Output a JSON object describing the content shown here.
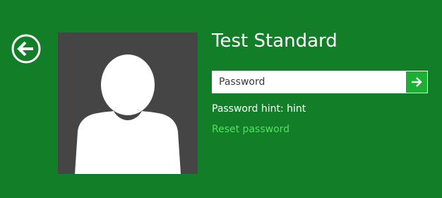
{
  "user": {
    "name": "Test Standard"
  },
  "password": {
    "placeholder": "Password",
    "value": ""
  },
  "hint": {
    "label": "Password hint:",
    "value": "hint"
  },
  "links": {
    "reset_password": "Reset password"
  },
  "icons": {
    "back": "back-arrow-icon",
    "submit": "right-arrow-icon",
    "avatar": "default-user-silhouette-icon"
  },
  "colors": {
    "background": "#127f28",
    "avatar_tile": "#454546",
    "submit_button": "#1dae34",
    "link": "#4fe15f",
    "text": "#ffffff"
  }
}
